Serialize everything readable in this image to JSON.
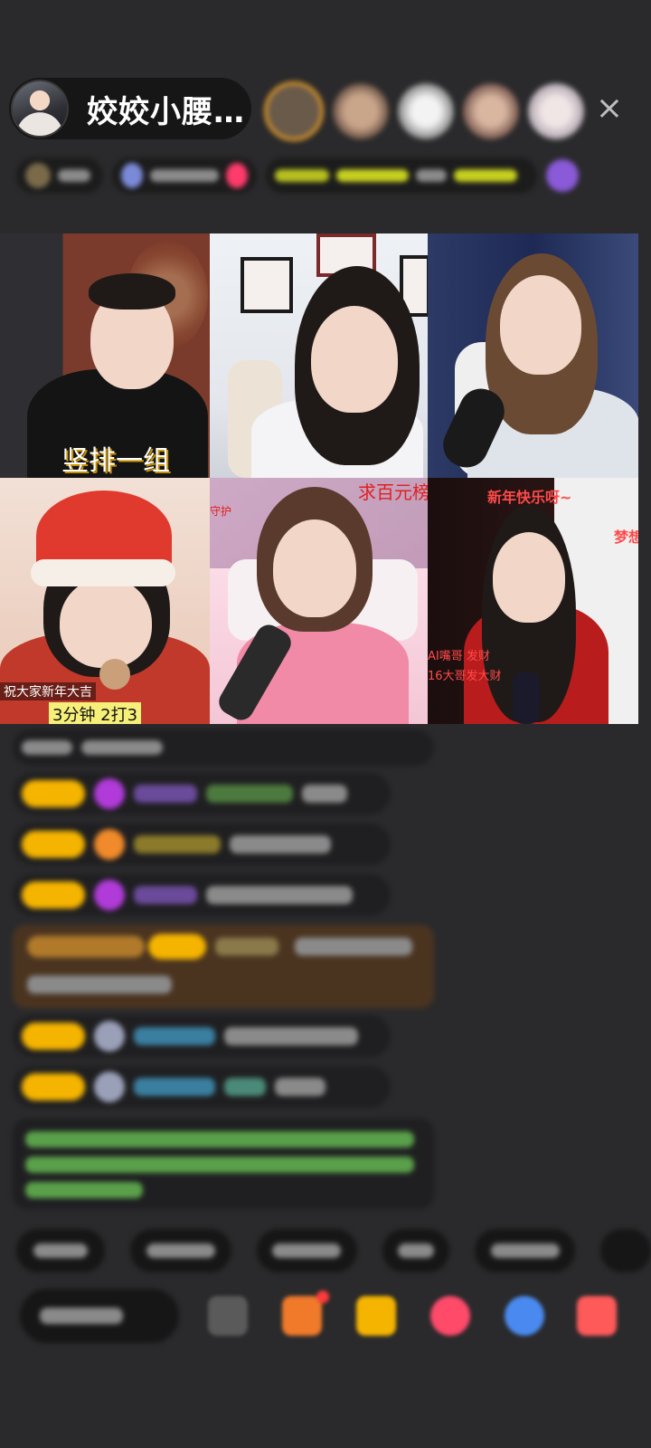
{
  "header": {
    "host_name": "姣姣小腰…",
    "close_glyph": "×"
  },
  "grid": {
    "tiles": [
      {
        "id": "tile-1",
        "overlay": "竖排一组"
      },
      {
        "id": "tile-2",
        "overlay": ""
      },
      {
        "id": "tile-3",
        "overlay": ""
      },
      {
        "id": "tile-4",
        "overlay_bottom_left": "祝大家新年大吉",
        "overlay_timer": "3分钟 2打3"
      },
      {
        "id": "tile-5",
        "overlay_top_right": "求百元榜",
        "overlay_top_left": "守护"
      },
      {
        "id": "tile-6",
        "overlay_top": "新年快乐呀~",
        "overlay_side": "梦想",
        "overlay_left1": "AI嘴哥 发财",
        "overlay_left2": "16大哥发大财"
      }
    ]
  },
  "colors": {
    "background": "#2a2a2c",
    "badge": "#f5b400",
    "accent_pink": "#ff3b6b"
  },
  "icons": {
    "close": "close-icon",
    "gift": "gift-icon"
  }
}
